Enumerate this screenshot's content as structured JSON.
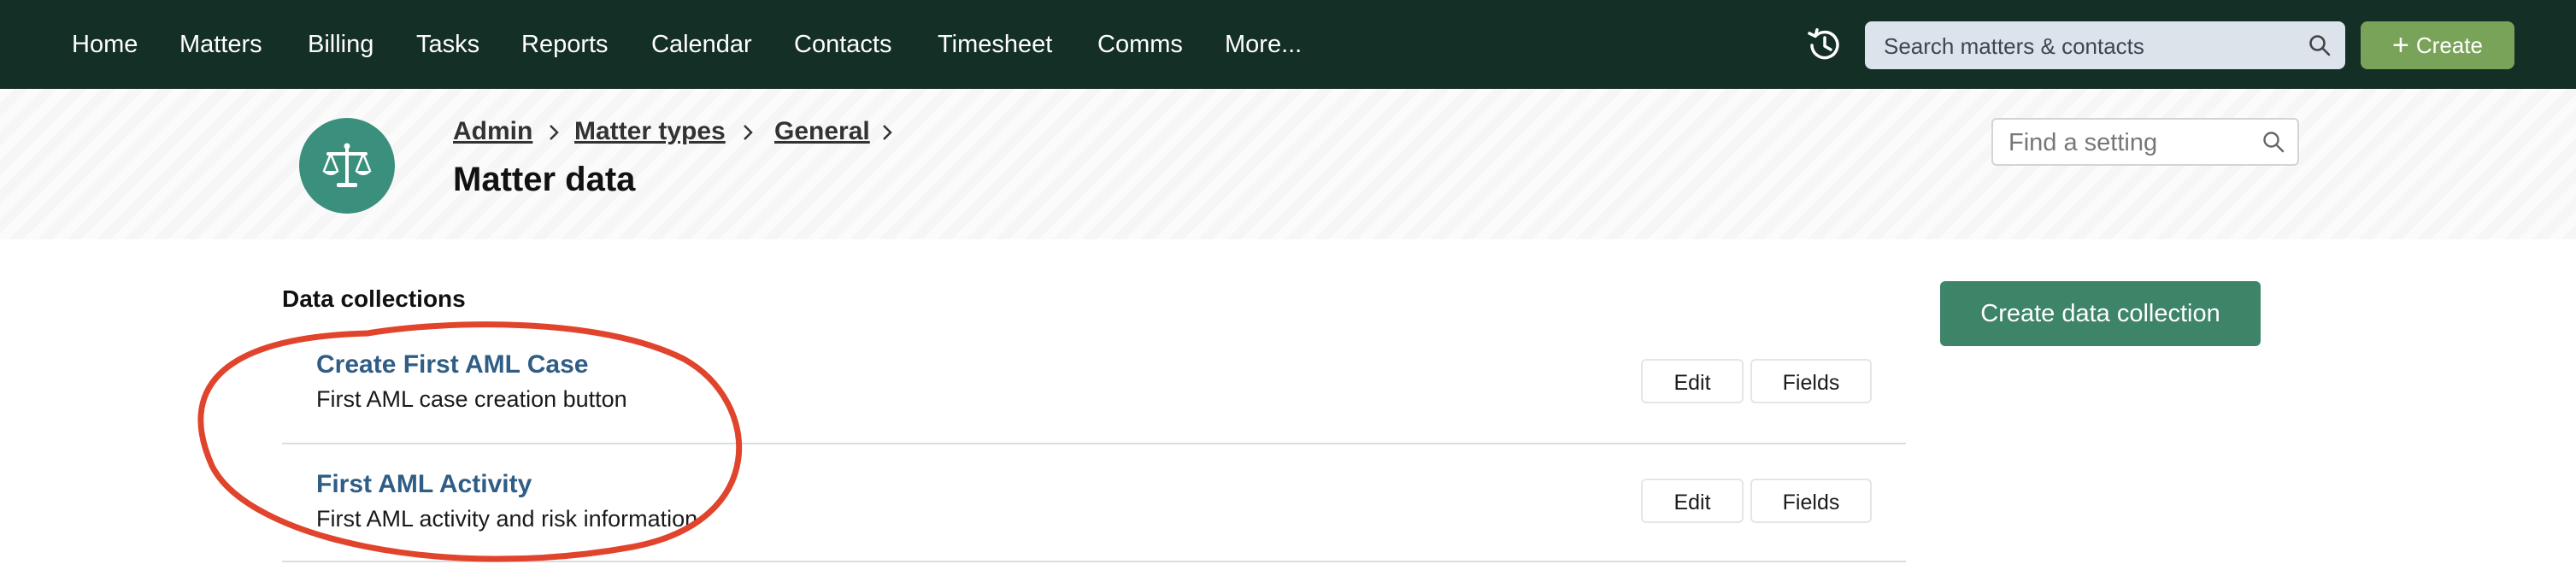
{
  "nav": {
    "items": [
      "Home",
      "Matters",
      "Billing",
      "Tasks",
      "Reports",
      "Calendar",
      "Contacts",
      "Timesheet",
      "Comms",
      "More..."
    ],
    "search_placeholder": "Search matters & contacts",
    "create_label": "Create"
  },
  "header": {
    "breadcrumb": [
      "Admin",
      "Matter types",
      "General"
    ],
    "title": "Matter data",
    "find_placeholder": "Find a setting"
  },
  "main": {
    "section_title": "Data collections",
    "create_button": "Create data collection",
    "collections": [
      {
        "title": "Create First AML Case",
        "description": "First AML case creation button",
        "edit_label": "Edit",
        "fields_label": "Fields"
      },
      {
        "title": "First AML Activity",
        "description": "First AML activity and risk information",
        "edit_label": "Edit",
        "fields_label": "Fields"
      }
    ]
  },
  "colors": {
    "nav_bg": "#132f26",
    "create_btn": "#7aa35a",
    "primary_btn": "#3e8468",
    "avatar_bg": "#3a8f7d",
    "link": "#2f5d86",
    "annotation": "#e1442c"
  },
  "icons": {
    "history": "history-icon",
    "search": "search-icon",
    "avatar": "scales-icon",
    "separator": "chevron-right-icon"
  }
}
